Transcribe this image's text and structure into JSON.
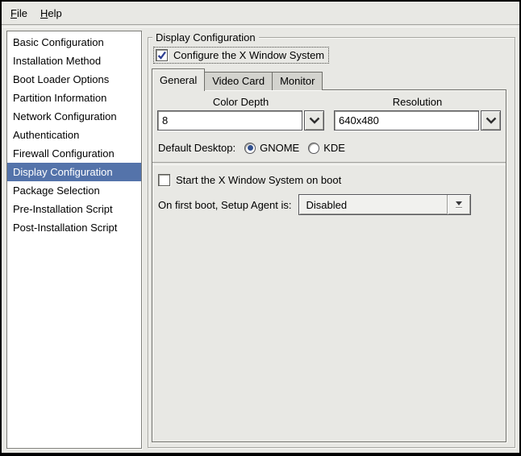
{
  "colors": {
    "selection_blue": "#5473aa",
    "check_blue": "#2f3f92",
    "radio_dot_blue": "#31508f",
    "window_bg": "#e8e8e4"
  },
  "menubar": {
    "file_label": "File",
    "help_label": "Help"
  },
  "sidebar": {
    "selected": "Display Configuration",
    "items": [
      {
        "label": "Basic Configuration"
      },
      {
        "label": "Installation Method"
      },
      {
        "label": "Boot Loader Options"
      },
      {
        "label": "Partition Information"
      },
      {
        "label": "Network Configuration"
      },
      {
        "label": "Authentication"
      },
      {
        "label": "Firewall Configuration"
      },
      {
        "label": "Display Configuration"
      },
      {
        "label": "Package Selection"
      },
      {
        "label": "Pre-Installation Script"
      },
      {
        "label": "Post-Installation Script"
      }
    ]
  },
  "display_configuration": {
    "frame_title": "Display Configuration",
    "configure_x": {
      "label": "Configure the X Window System",
      "checked": true
    },
    "tabs": {
      "general": "General",
      "video_card": "Video Card",
      "monitor": "Monitor",
      "active": "General"
    },
    "general": {
      "color_depth_label": "Color Depth",
      "color_depth_value": "8",
      "resolution_label": "Resolution",
      "resolution_value": "640x480",
      "default_desktop_label": "Default Desktop:",
      "gnome_label": "GNOME",
      "kde_label": "KDE",
      "default_desktop_selected": "GNOME",
      "start_x": {
        "label": "Start the X Window System on boot",
        "checked": false
      },
      "setup_agent_label": "On first boot, Setup Agent is:",
      "setup_agent_value": "Disabled"
    }
  }
}
